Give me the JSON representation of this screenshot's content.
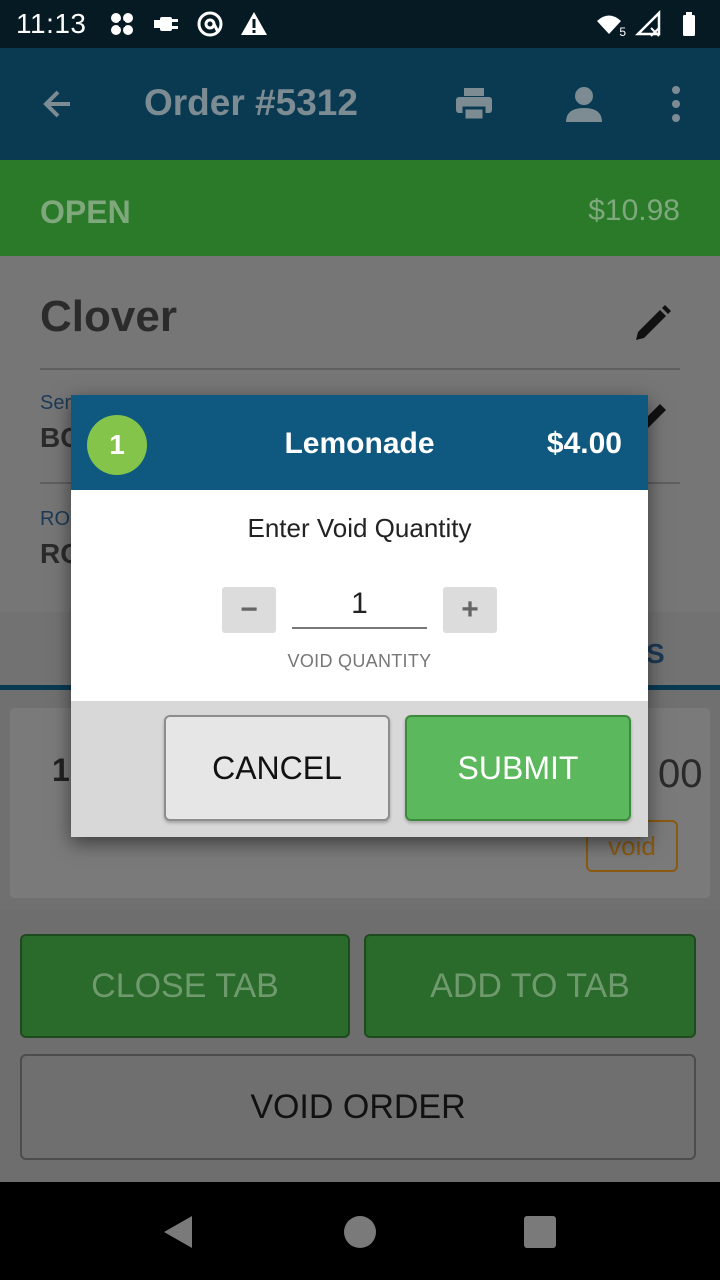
{
  "status_bar": {
    "time": "11:13",
    "left_icons": [
      "clover-icon",
      "usb-plug-icon",
      "at-sign-icon",
      "warning-icon"
    ],
    "right_icons": [
      "wifi-icon",
      "cellular-off-icon",
      "battery-icon"
    ],
    "wifi_badge": "5"
  },
  "app_bar": {
    "title": "Order #5312"
  },
  "order": {
    "status": "OPEN",
    "total": "$10.98"
  },
  "customer": {
    "name": "Clover",
    "field1_label_partial": "Ser",
    "field1_value_partial": "BC",
    "field2_label_partial": "RO",
    "field2_value_partial": "RO"
  },
  "tabs": {
    "right_tab_partial": "S"
  },
  "line_item": {
    "qty_partial": "1",
    "price_partial": "00",
    "void_label": "void"
  },
  "actions": {
    "close_tab": "CLOSE TAB",
    "add_to_tab": "ADD TO TAB",
    "void_order": "VOID ORDER"
  },
  "dialog": {
    "badge_qty": "1",
    "item_name": "Lemonade",
    "item_price": "$4.00",
    "prompt": "Enter Void Quantity",
    "minus_label": "−",
    "plus_label": "+",
    "quantity_value": "1",
    "quantity_caption": "VOID QUANTITY",
    "cancel_label": "CANCEL",
    "submit_label": "SUBMIT"
  },
  "colors": {
    "app_bar": "#0a3a52",
    "open_strip": "#2b7a2a",
    "dialog_header": "#0f5880",
    "badge": "#84c44a",
    "submit": "#5cb85c"
  }
}
